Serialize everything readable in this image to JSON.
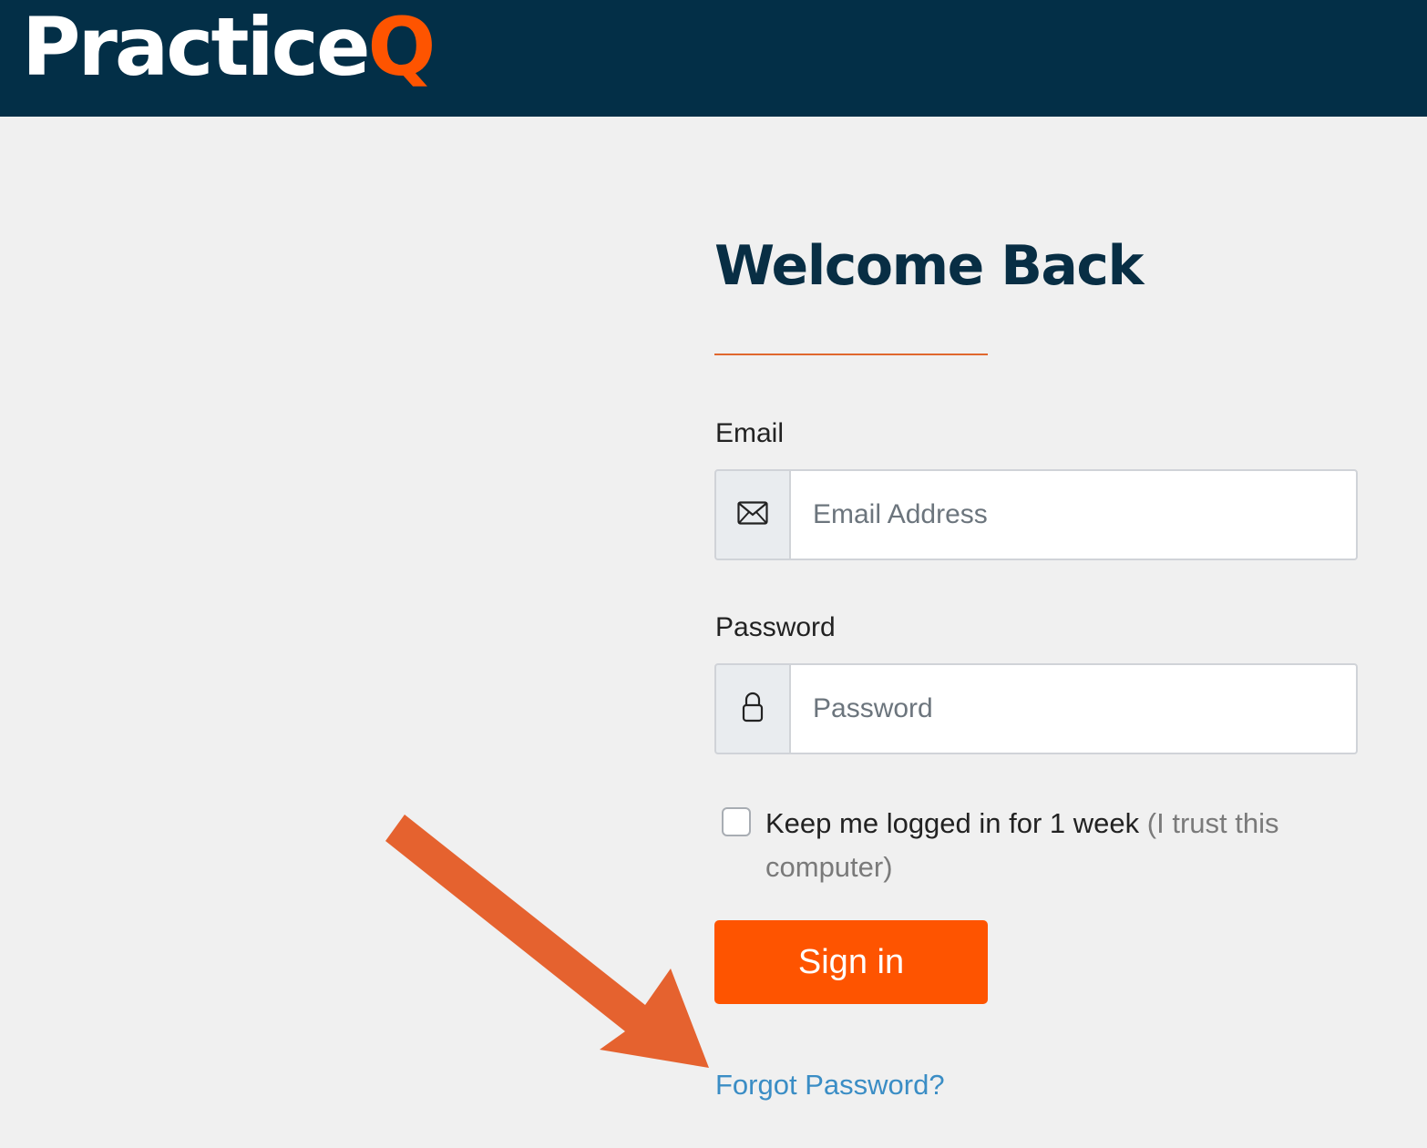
{
  "brand": {
    "logo_main": "Practice",
    "logo_accent": "Q",
    "header_color": "#032f47",
    "accent_color": "#fe5400"
  },
  "login": {
    "title": "Welcome Back",
    "email_label": "Email",
    "email_placeholder": "Email Address",
    "email_icon": "envelope-icon",
    "password_label": "Password",
    "password_placeholder": "Password",
    "password_icon": "lock-icon",
    "remember_text": "Keep me logged in for 1 week",
    "remember_hint": "(I trust this computer)",
    "remember_checked": false,
    "signin_label": "Sign in",
    "forgot_label": "Forgot Password?"
  },
  "annotation": {
    "arrow_color": "#e5622f",
    "arrow_target": "forgot-password-link"
  }
}
